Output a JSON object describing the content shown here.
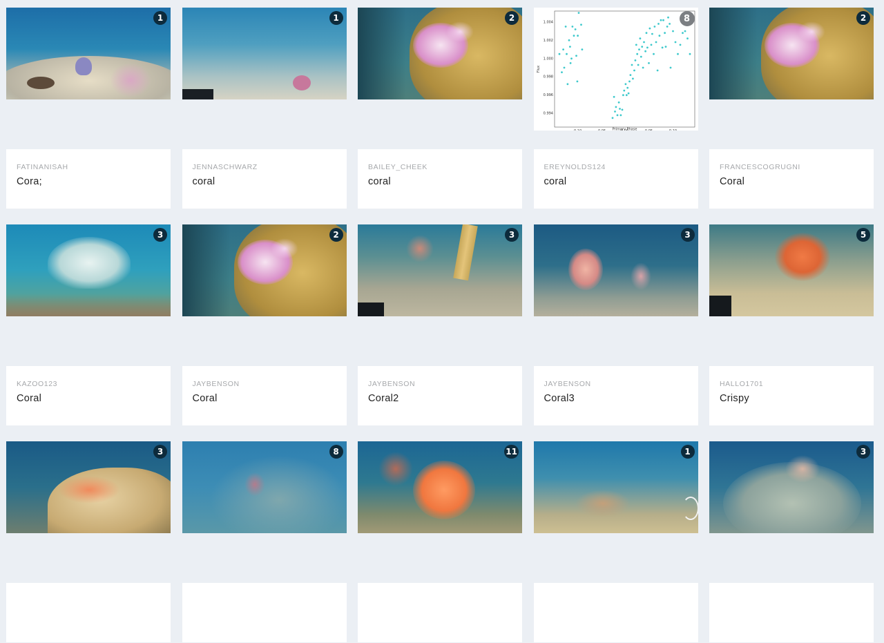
{
  "cards": [
    {
      "user": "FATINANISAH",
      "title": "Cora;",
      "count": "1",
      "scene": "reef-floor-purple"
    },
    {
      "user": "JENNASCHWARZ",
      "title": "coral",
      "count": "1",
      "scene": "sand-floor-pink"
    },
    {
      "user": "BAILEY_CHEEK",
      "title": "coral",
      "count": "2",
      "scene": "rock-pink-softcoral"
    },
    {
      "user": "EREYNOLDS124",
      "title": "coral",
      "count": "8",
      "scene": "scatter-plot"
    },
    {
      "user": "FRANCESCOGRUGNI",
      "title": "Coral",
      "count": "2",
      "scene": "rock-pink-softcoral"
    },
    {
      "user": "KAZOO123",
      "title": "Coral",
      "count": "3",
      "scene": "white-fan-coral"
    },
    {
      "user": "JAYBENSON",
      "title": "Coral",
      "count": "2",
      "scene": "rock-pink-softcoral"
    },
    {
      "user": "JAYBENSON",
      "title": "Coral2",
      "count": "3",
      "scene": "sand-floor-sea-pen"
    },
    {
      "user": "JAYBENSON",
      "title": "Coral3",
      "count": "3",
      "scene": "pink-coral-cluster"
    },
    {
      "user": "HALLO1701",
      "title": "Crispy",
      "count": "5",
      "scene": "orange-branching-coral"
    },
    {
      "user": "",
      "title": "",
      "count": "3",
      "scene": "orange-sponge-rock"
    },
    {
      "user": "",
      "title": "",
      "count": "8",
      "scene": "blue-hazy-reef"
    },
    {
      "user": "",
      "title": "",
      "count": "11",
      "scene": "orange-sea-fan"
    },
    {
      "user": "",
      "title": "",
      "count": "1",
      "scene": "sandy-slope"
    },
    {
      "user": "",
      "title": "",
      "count": "3",
      "scene": "whip-coral-rock"
    }
  ],
  "chart_data": {
    "type": "scatter",
    "xlabel": "Primary Phase",
    "ylabel": "Flux",
    "xticks": [
      "−0.10",
      "−0.05",
      "0.00",
      "0.05",
      "0.10"
    ],
    "yticks": [
      "0.994",
      "0.996",
      "0.998",
      "1.000",
      "1.002",
      "1.004"
    ],
    "xlim": [
      -0.145,
      0.145
    ],
    "ylim": [
      0.9925,
      1.0052
    ],
    "color": "#3ec9cc",
    "points": [
      [
        -0.135,
        1.0005
      ],
      [
        -0.13,
        0.9985
      ],
      [
        -0.127,
        1.001
      ],
      [
        -0.125,
        0.999
      ],
      [
        -0.122,
        1.0035
      ],
      [
        -0.12,
        1.0005
      ],
      [
        -0.118,
        0.9972
      ],
      [
        -0.115,
        1.002
      ],
      [
        -0.113,
        1.0013
      ],
      [
        -0.112,
        0.9995
      ],
      [
        -0.11,
        1.0
      ],
      [
        -0.108,
        1.0035
      ],
      [
        -0.105,
        1.0025
      ],
      [
        -0.102,
        1.0032
      ],
      [
        -0.1,
        1.0003
      ],
      [
        -0.098,
        0.9975
      ],
      [
        -0.097,
        1.0025
      ],
      [
        -0.095,
        1.005
      ],
      [
        -0.09,
        1.0037
      ],
      [
        -0.088,
        1.001
      ],
      [
        -0.025,
        0.9935
      ],
      [
        -0.022,
        0.9958
      ],
      [
        -0.02,
        0.9942
      ],
      [
        -0.018,
        0.9947
      ],
      [
        -0.015,
        0.9938
      ],
      [
        -0.012,
        0.9952
      ],
      [
        -0.01,
        0.9945
      ],
      [
        -0.008,
        0.9938
      ],
      [
        -0.005,
        0.9944
      ],
      [
        -0.003,
        0.996
      ],
      [
        -0.001,
        0.9965
      ],
      [
        0.002,
        0.9972
      ],
      [
        0.004,
        0.996
      ],
      [
        0.006,
        0.9968
      ],
      [
        0.008,
        0.9962
      ],
      [
        0.01,
        0.9975
      ],
      [
        0.012,
        0.9982
      ],
      [
        0.015,
        0.9993
      ],
      [
        0.017,
        0.9978
      ],
      [
        0.02,
        0.9987
      ],
      [
        0.022,
        0.9998
      ],
      [
        0.024,
        1.0015
      ],
      [
        0.026,
        1.0005
      ],
      [
        0.028,
        0.9993
      ],
      [
        0.03,
        1.001
      ],
      [
        0.032,
        1.0022
      ],
      [
        0.034,
        1.0002
      ],
      [
        0.036,
        1.0013
      ],
      [
        0.038,
        0.999
      ],
      [
        0.04,
        1.0018
      ],
      [
        0.043,
        1.0008
      ],
      [
        0.045,
        1.0028
      ],
      [
        0.047,
        1.0012
      ],
      [
        0.05,
        0.9995
      ],
      [
        0.052,
        1.0033
      ],
      [
        0.055,
        1.0015
      ],
      [
        0.057,
        1.0027
      ],
      [
        0.06,
        1.0005
      ],
      [
        0.062,
        1.0035
      ],
      [
        0.065,
        1.0018
      ],
      [
        0.068,
        0.9987
      ],
      [
        0.07,
        1.0038
      ],
      [
        0.072,
        1.0025
      ],
      [
        0.075,
        1.0042
      ],
      [
        0.078,
        1.0012
      ],
      [
        0.08,
        1.0042
      ],
      [
        0.083,
        1.0028
      ],
      [
        0.085,
        1.0013
      ],
      [
        0.088,
        1.0035
      ],
      [
        0.09,
        1.0045
      ],
      [
        0.093,
        1.0038
      ],
      [
        0.095,
        0.999
      ],
      [
        0.1,
        1.003
      ],
      [
        0.105,
        1.0018
      ],
      [
        0.11,
        1.0005
      ],
      [
        0.115,
        1.0015
      ],
      [
        0.12,
        1.0028
      ],
      [
        0.125,
        1.003
      ],
      [
        0.13,
        1.0022
      ],
      [
        0.135,
        1.0005
      ]
    ]
  }
}
